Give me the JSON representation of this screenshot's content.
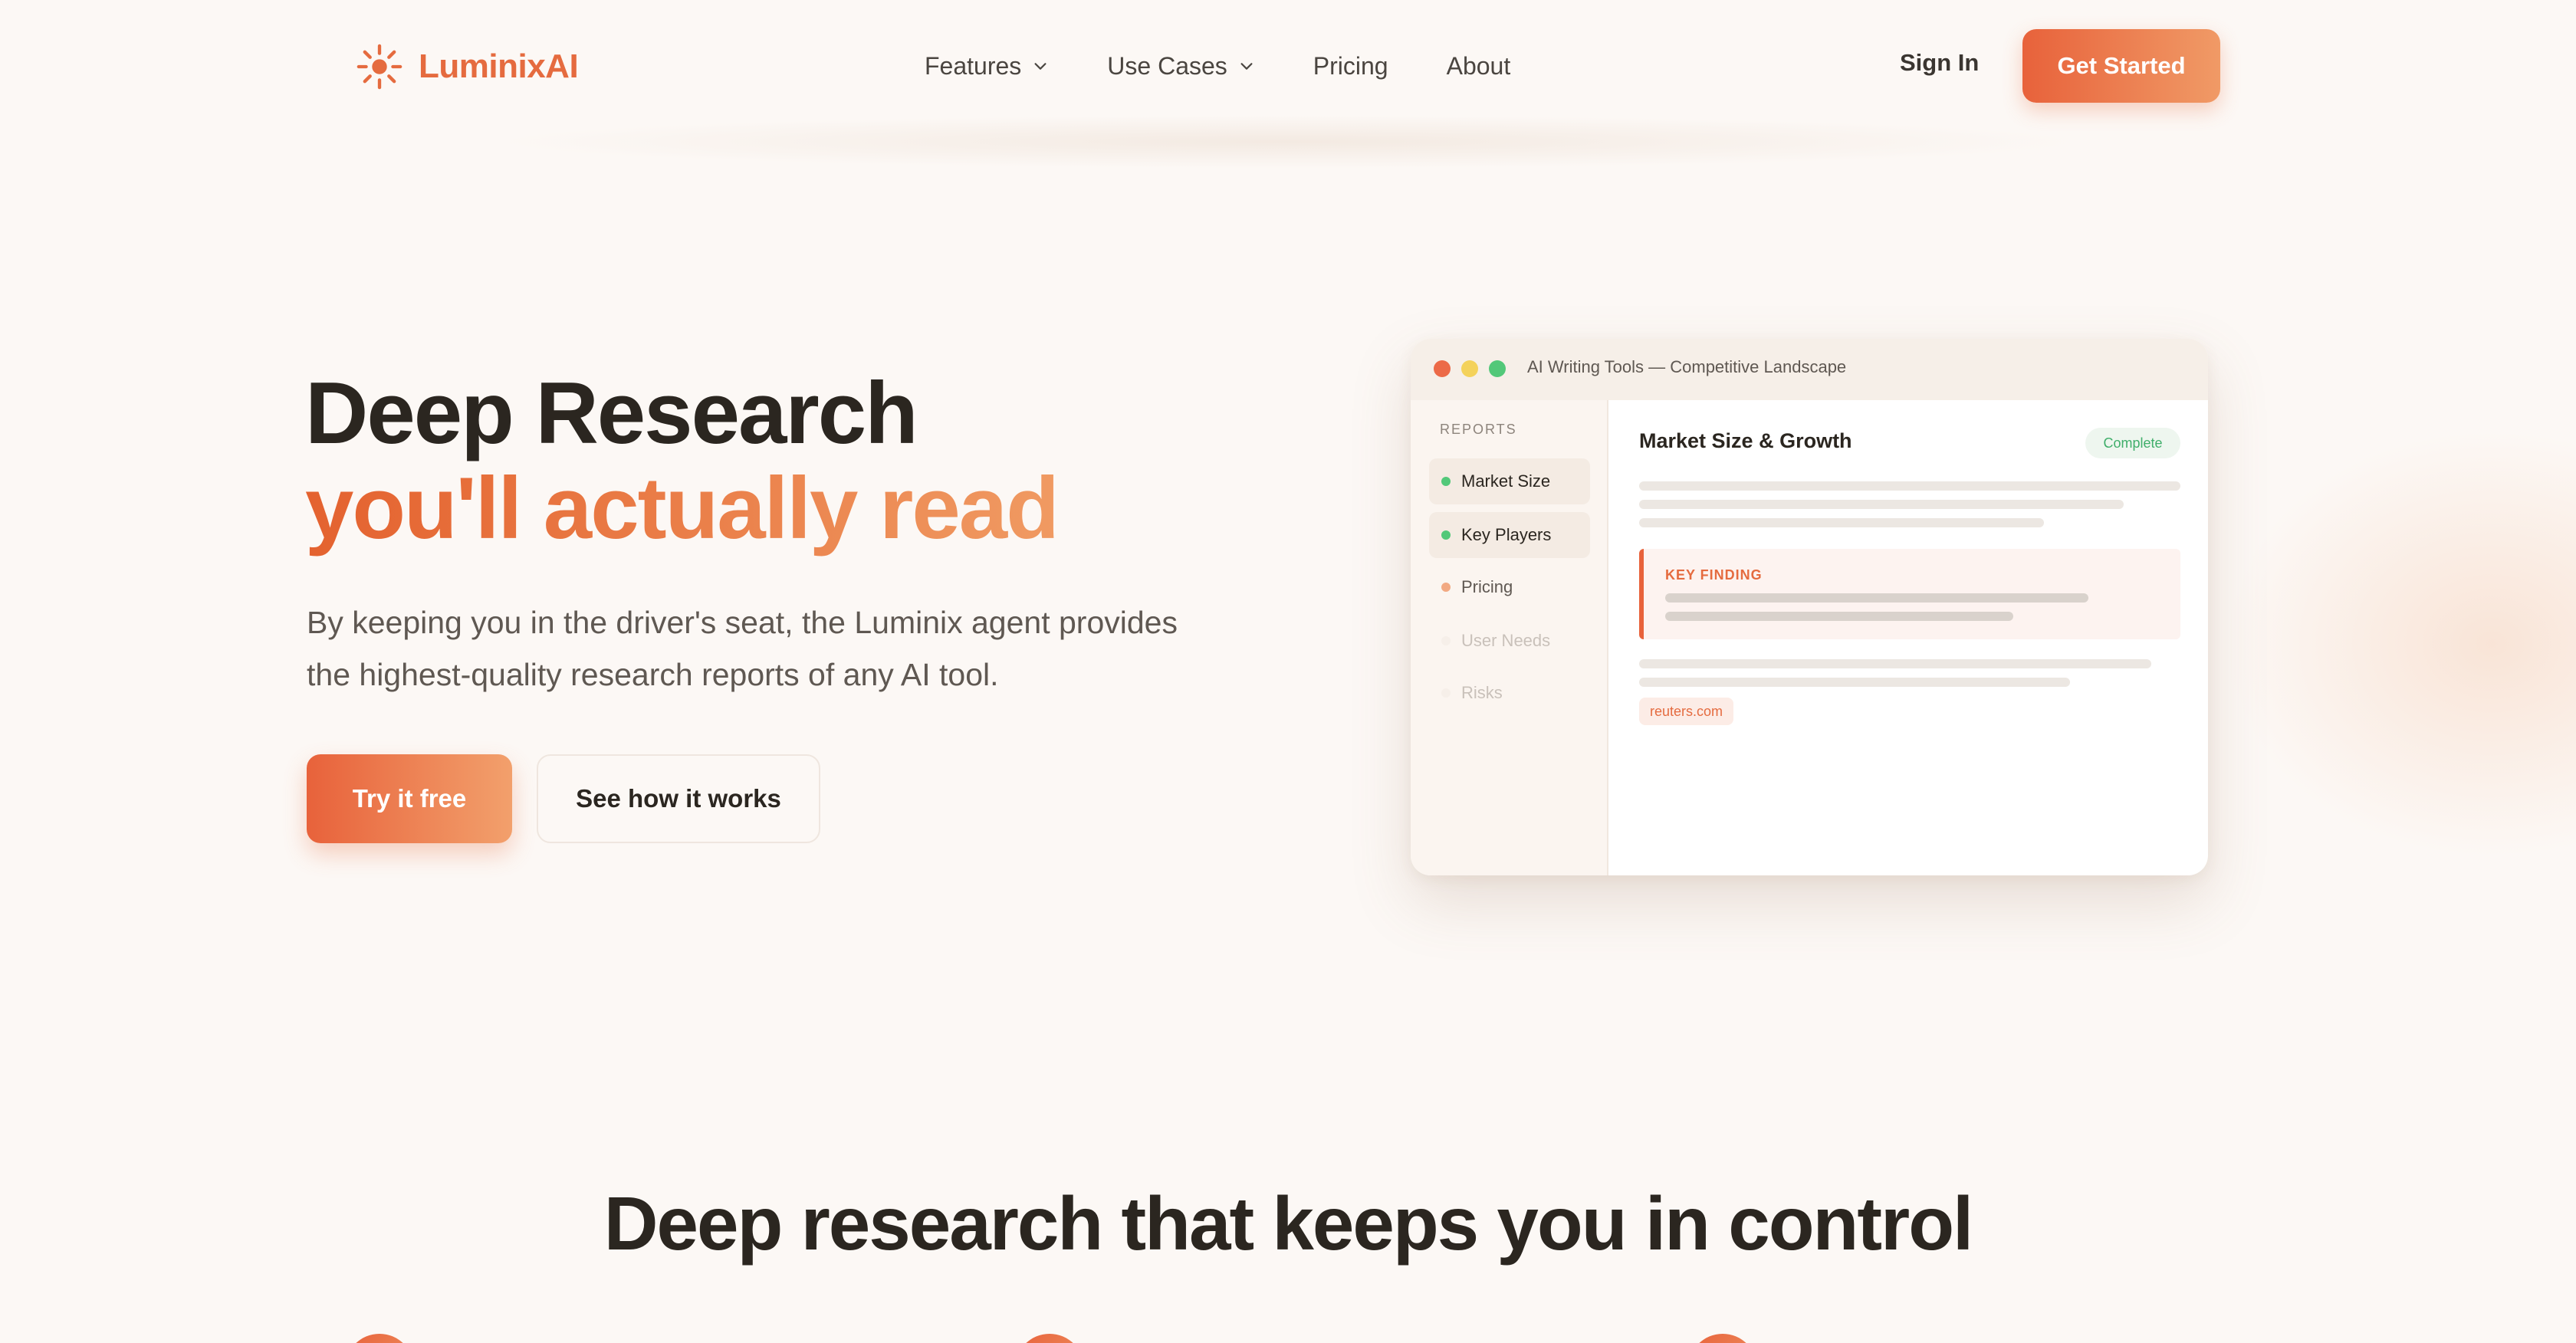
{
  "brand": {
    "name": "LuminixAI",
    "accent": "#e56b3f"
  },
  "nav": {
    "items": [
      {
        "label": "Features",
        "has_dropdown": true
      },
      {
        "label": "Use Cases",
        "has_dropdown": true
      },
      {
        "label": "Pricing",
        "has_dropdown": false
      },
      {
        "label": "About",
        "has_dropdown": false
      }
    ],
    "sign_in": "Sign In",
    "get_started": "Get Started"
  },
  "hero": {
    "title_line1": "Deep Research",
    "title_line2": "you'll actually read",
    "subtitle_line1": "By keeping you in the driver's seat, the Luminix agent provides",
    "subtitle_line2": "the highest-quality research reports of any AI tool.",
    "primary_cta": "Try it free",
    "secondary_cta": "See how it works"
  },
  "mockup": {
    "window_title": "AI Writing Tools — Competitive Landscape",
    "sidebar_label": "REPORTS",
    "reports": [
      {
        "label": "Market Size",
        "status": "done",
        "dot_color": "#52c879",
        "text_color": "#2b2620"
      },
      {
        "label": "Key Players",
        "status": "done",
        "dot_color": "#52c879",
        "text_color": "#2b2620"
      },
      {
        "label": "Pricing",
        "status": "in-progress",
        "dot_color": "#f2a982",
        "text_color": "#5f5852"
      },
      {
        "label": "User Needs",
        "status": "pending",
        "dot_color": "#f6efe9",
        "text_color": "#c9c1ba"
      },
      {
        "label": "Risks",
        "status": "pending",
        "dot_color": "#f6efe9",
        "text_color": "#c9c1ba"
      }
    ],
    "main_heading": "Market Size & Growth",
    "status_badge": "Complete",
    "finding_label": "KEY FINDING",
    "source_tag": "reuters.com"
  },
  "section": {
    "title": "Deep research that keeps you in control"
  }
}
